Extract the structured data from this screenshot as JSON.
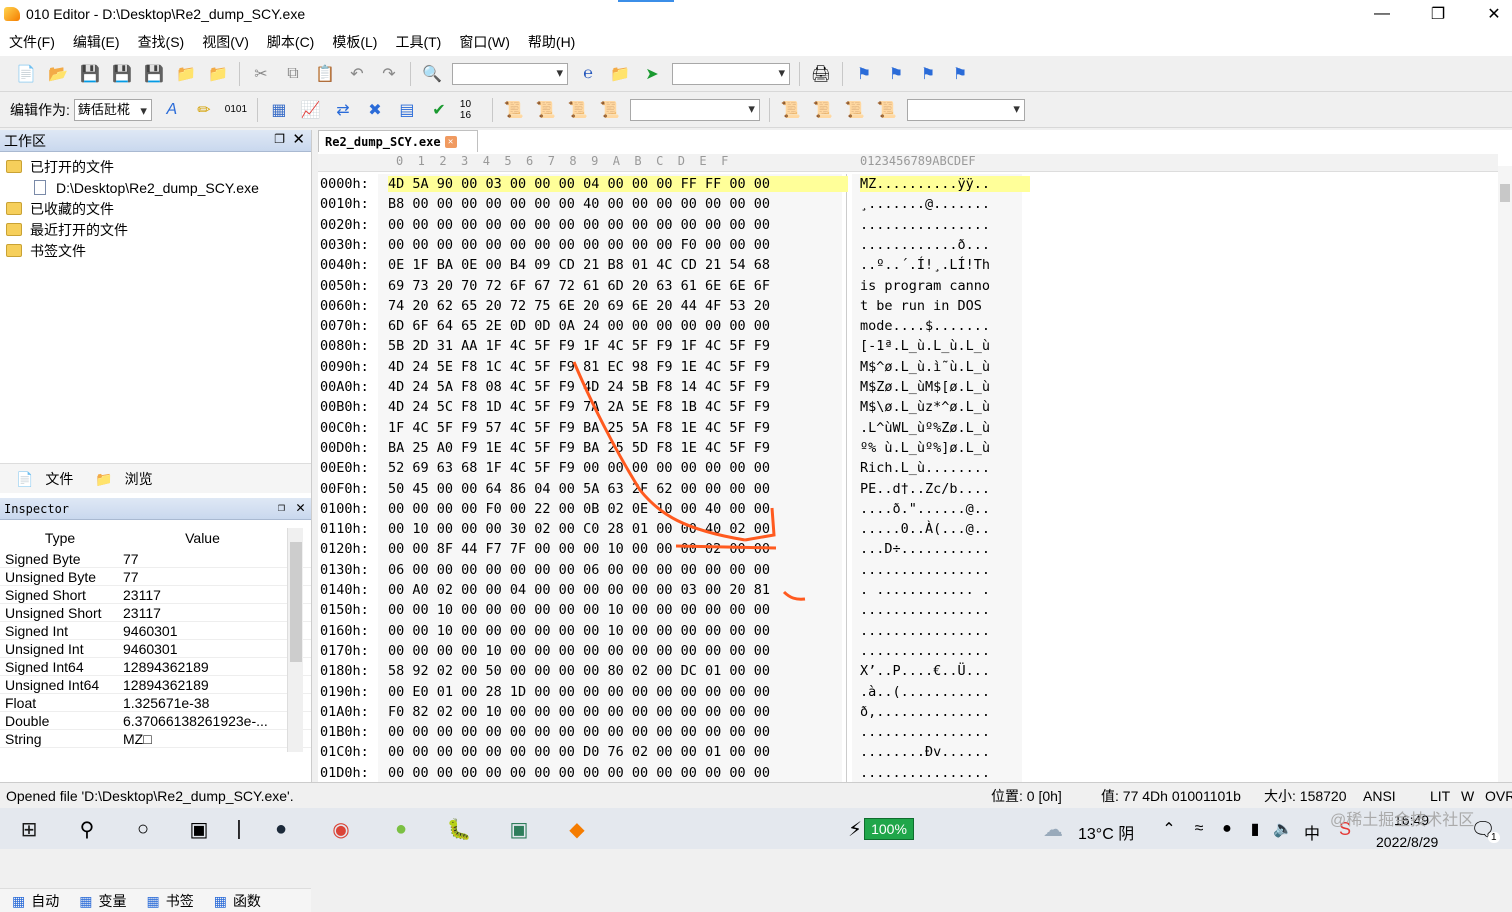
{
  "window": {
    "title": "010 Editor - D:\\Desktop\\Re2_dump_SCY.exe"
  },
  "menu": [
    "文件(F)",
    "编辑(E)",
    "查找(S)",
    "视图(V)",
    "脚本(C)",
    "模板(L)",
    "工具(T)",
    "窗口(W)",
    "帮助(H)"
  ],
  "toolbar2": {
    "edit_as_label": "编辑作为:",
    "edit_as_value": "鋳佸瓧椛"
  },
  "workspace": {
    "title": "工作区",
    "opened_files": "已打开的文件",
    "file_path": "D:\\Desktop\\Re2_dump_SCY.exe",
    "favorites": "已收藏的文件",
    "recent": "最近打开的文件",
    "bookmarks": "书签文件",
    "tab_file": "文件",
    "tab_browse": "浏览"
  },
  "inspector": {
    "title": "Inspector",
    "col_type": "Type",
    "col_value": "Value",
    "rows": [
      {
        "type": "Signed Byte",
        "value": "77"
      },
      {
        "type": "Unsigned Byte",
        "value": "77"
      },
      {
        "type": "Signed Short",
        "value": "23117"
      },
      {
        "type": "Unsigned Short",
        "value": "23117"
      },
      {
        "type": "Signed Int",
        "value": "9460301"
      },
      {
        "type": "Unsigned Int",
        "value": "9460301"
      },
      {
        "type": "Signed Int64",
        "value": "12894362189"
      },
      {
        "type": "Unsigned Int64",
        "value": "12894362189"
      },
      {
        "type": "Float",
        "value": "1.325671e-38"
      },
      {
        "type": "Double",
        "value": "6.37066138261923e-..."
      },
      {
        "type": "String",
        "value": "MZ□"
      }
    ],
    "tabs": [
      "自动",
      "变量",
      "书签",
      "函数"
    ]
  },
  "editor": {
    "file_tab": "Re2_dump_SCY.exe",
    "col_header_hex": "0  1  2  3  4  5  6  7  8  9  A  B  C  D  E  F",
    "col_header_ascii": "0123456789ABCDEF",
    "rows": [
      {
        "addr": "0000h:",
        "hex": "4D 5A 90 00 03 00 00 00 04 00 00 00 FF FF 00 00",
        "ascii": "MZ..........ÿÿ.."
      },
      {
        "addr": "0010h:",
        "hex": "B8 00 00 00 00 00 00 00 40 00 00 00 00 00 00 00",
        "ascii": "¸.......@......."
      },
      {
        "addr": "0020h:",
        "hex": "00 00 00 00 00 00 00 00 00 00 00 00 00 00 00 00",
        "ascii": "................"
      },
      {
        "addr": "0030h:",
        "hex": "00 00 00 00 00 00 00 00 00 00 00 00 F0 00 00 00",
        "ascii": "............ð..."
      },
      {
        "addr": "0040h:",
        "hex": "0E 1F BA 0E 00 B4 09 CD 21 B8 01 4C CD 21 54 68",
        "ascii": "..º..´.Í!¸.LÍ!Th"
      },
      {
        "addr": "0050h:",
        "hex": "69 73 20 70 72 6F 67 72 61 6D 20 63 61 6E 6E 6F",
        "ascii": "is program canno"
      },
      {
        "addr": "0060h:",
        "hex": "74 20 62 65 20 72 75 6E 20 69 6E 20 44 4F 53 20",
        "ascii": "t be run in DOS "
      },
      {
        "addr": "0070h:",
        "hex": "6D 6F 64 65 2E 0D 0D 0A 24 00 00 00 00 00 00 00",
        "ascii": "mode....$......."
      },
      {
        "addr": "0080h:",
        "hex": "5B 2D 31 AA 1F 4C 5F F9 1F 4C 5F F9 1F 4C 5F F9",
        "ascii": "[-1ª.L_ù.L_ù.L_ù"
      },
      {
        "addr": "0090h:",
        "hex": "4D 24 5E F8 1C 4C 5F F9 81 EC 98 F9 1E 4C 5F F9",
        "ascii": "M$^ø.L_ù.ì˜ù.L_ù"
      },
      {
        "addr": "00A0h:",
        "hex": "4D 24 5A F8 08 4C 5F F9 4D 24 5B F8 14 4C 5F F9",
        "ascii": "M$Zø.L_ùM$[ø.L_ù"
      },
      {
        "addr": "00B0h:",
        "hex": "4D 24 5C F8 1D 4C 5F F9 7A 2A 5E F8 1B 4C 5F F9",
        "ascii": "M$\\ø.L_ùz*^ø.L_ù"
      },
      {
        "addr": "00C0h:",
        "hex": "1F 4C 5F F9 57 4C 5F F9 BA 25 5A F8 1E 4C 5F F9",
        "ascii": ".L^ùWL_ùº%Zø.L_ù"
      },
      {
        "addr": "00D0h:",
        "hex": "BA 25 A0 F9 1E 4C 5F F9 BA 25 5D F8 1E 4C 5F F9",
        "ascii": "º% ù.L_ùº%]ø.L_ù"
      },
      {
        "addr": "00E0h:",
        "hex": "52 69 63 68 1F 4C 5F F9 00 00 00 00 00 00 00 00",
        "ascii": "Rich.L_ù........"
      },
      {
        "addr": "00F0h:",
        "hex": "50 45 00 00 64 86 04 00 5A 63 2F 62 00 00 00 00",
        "ascii": "PE..d†..Zc/b...."
      },
      {
        "addr": "0100h:",
        "hex": "00 00 00 00 F0 00 22 00 0B 02 0E 10 00 40 00 00",
        "ascii": "....ð.\"......@.."
      },
      {
        "addr": "0110h:",
        "hex": "00 10 00 00 00 30 02 00 C0 28 01 00 00 40 02 00",
        "ascii": ".....0..À(...@.."
      },
      {
        "addr": "0120h:",
        "hex": "00 00 8F 44 F7 7F 00 00 00 10 00 00 00 02 00 00",
        "ascii": "...D÷..........."
      },
      {
        "addr": "0130h:",
        "hex": "06 00 00 00 00 00 00 00 06 00 00 00 00 00 00 00",
        "ascii": "................"
      },
      {
        "addr": "0140h:",
        "hex": "00 A0 02 00 00 04 00 00 00 00 00 00 03 00 20 81",
        "ascii": ". ............ ."
      },
      {
        "addr": "0150h:",
        "hex": "00 00 10 00 00 00 00 00 00 10 00 00 00 00 00 00",
        "ascii": "................"
      },
      {
        "addr": "0160h:",
        "hex": "00 00 10 00 00 00 00 00 00 10 00 00 00 00 00 00",
        "ascii": "................"
      },
      {
        "addr": "0170h:",
        "hex": "00 00 00 00 10 00 00 00 00 00 00 00 00 00 00 00",
        "ascii": "................"
      },
      {
        "addr": "0180h:",
        "hex": "58 92 02 00 50 00 00 00 00 80 02 00 DC 01 00 00",
        "ascii": "X’..P....€..Ü..."
      },
      {
        "addr": "0190h:",
        "hex": "00 E0 01 00 28 1D 00 00 00 00 00 00 00 00 00 00",
        "ascii": ".à..(..........."
      },
      {
        "addr": "01A0h:",
        "hex": "F0 82 02 00 10 00 00 00 00 00 00 00 00 00 00 00",
        "ascii": "ð,.............."
      },
      {
        "addr": "01B0h:",
        "hex": "00 00 00 00 00 00 00 00 00 00 00 00 00 00 00 00",
        "ascii": "................"
      },
      {
        "addr": "01C0h:",
        "hex": "00 00 00 00 00 00 00 00 D0 76 02 00 00 01 00 00",
        "ascii": "........Ðv......"
      },
      {
        "addr": "01D0h:",
        "hex": "00 00 00 00 00 00 00 00 00 00 00 00 00 00 00 00",
        "ascii": "................"
      }
    ]
  },
  "status": {
    "message": "Opened file 'D:\\Desktop\\Re2_dump_SCY.exe'.",
    "position": "位置: 0 [0h]",
    "value": "值: 77 4Dh 01001101b",
    "size": "大小: 158720",
    "encoding": "ANSI",
    "endian": "LIT",
    "mode_w": "W",
    "mode_ovr": "OVR"
  },
  "taskbar": {
    "battery": "100%",
    "weather": "13°C 阴",
    "ime": "中",
    "time": "16:49",
    "date": "2022/8/29",
    "notifications": "1"
  },
  "watermark": "@稀土掘金技术社区",
  "colors": {
    "highlight_row": "#ffff99",
    "annotation_stroke": "#ff5a1f",
    "panel_title": "#c9d8ee"
  }
}
